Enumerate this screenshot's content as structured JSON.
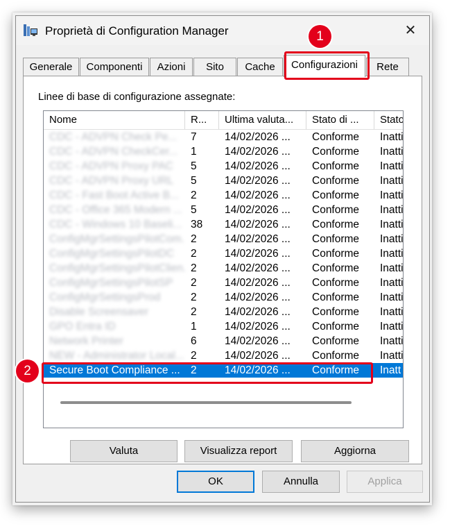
{
  "window": {
    "title": "Proprietà di Configuration Manager",
    "close_glyph": "✕",
    "icon": "configmgr-app-icon"
  },
  "tabs": [
    {
      "label": "Generale"
    },
    {
      "label": "Componenti"
    },
    {
      "label": "Azioni"
    },
    {
      "label": "Sito"
    },
    {
      "label": "Cache"
    },
    {
      "label": "Configurazioni",
      "active": true
    },
    {
      "label": "Rete"
    }
  ],
  "panel": {
    "assigned_label": "Linee di base di configurazione assegnate:"
  },
  "list": {
    "columns": [
      "Nome",
      "R...",
      "Ultima valuta...",
      "Stato di ...",
      "Stato"
    ],
    "rows": [
      {
        "name": "CDC - ADVPN Check Pe...",
        "rev": "7",
        "last_eval": "14/02/2026 ...",
        "compliance": "Conforme",
        "state": "Inattivo",
        "obscured": true
      },
      {
        "name": "CDC - ADVPN CheckCer...",
        "rev": "1",
        "last_eval": "14/02/2026 ...",
        "compliance": "Conforme",
        "state": "Inattivo",
        "obscured": true
      },
      {
        "name": "CDC - ADVPN Proxy PAC",
        "rev": "5",
        "last_eval": "14/02/2026 ...",
        "compliance": "Conforme",
        "state": "Inattivo",
        "obscured": true
      },
      {
        "name": "CDC - ADVPN Proxy URL",
        "rev": "5",
        "last_eval": "14/02/2026 ...",
        "compliance": "Conforme",
        "state": "Inattivo",
        "obscured": true
      },
      {
        "name": "CDC - Fast Boot Active B...",
        "rev": "2",
        "last_eval": "14/02/2026 ...",
        "compliance": "Conforme",
        "state": "Inattivo",
        "obscured": true
      },
      {
        "name": "CDC - Office 365 Modern ...",
        "rev": "5",
        "last_eval": "14/02/2026 ...",
        "compliance": "Conforme",
        "state": "Inattivo",
        "obscured": true
      },
      {
        "name": "CDC - Windows 10 Baseli...",
        "rev": "38",
        "last_eval": "14/02/2026 ...",
        "compliance": "Conforme",
        "state": "Inattivo",
        "obscured": true
      },
      {
        "name": "ConfigMgrSettingsPilotCom...",
        "rev": "2",
        "last_eval": "14/02/2026 ...",
        "compliance": "Conforme",
        "state": "Inattivo",
        "obscured": true
      },
      {
        "name": "ConfigMgrSettingsPilotDC",
        "rev": "2",
        "last_eval": "14/02/2026 ...",
        "compliance": "Conforme",
        "state": "Inattivo",
        "obscured": true
      },
      {
        "name": "ConfigMgrSettingsPilotClien...",
        "rev": "2",
        "last_eval": "14/02/2026 ...",
        "compliance": "Conforme",
        "state": "Inattivo",
        "obscured": true
      },
      {
        "name": "ConfigMgrSettingsPilotSP",
        "rev": "2",
        "last_eval": "14/02/2026 ...",
        "compliance": "Conforme",
        "state": "Inattivo",
        "obscured": true
      },
      {
        "name": "ConfigMgrSettingsProd",
        "rev": "2",
        "last_eval": "14/02/2026 ...",
        "compliance": "Conforme",
        "state": "Inattivo",
        "obscured": true
      },
      {
        "name": "Disable Screensaver",
        "rev": "2",
        "last_eval": "14/02/2026 ...",
        "compliance": "Conforme",
        "state": "Inattivo",
        "obscured": true
      },
      {
        "name": "GPO Entra ID",
        "rev": "1",
        "last_eval": "14/02/2026 ...",
        "compliance": "Conforme",
        "state": "Inattivo",
        "obscured": true
      },
      {
        "name": "Network Printer",
        "rev": "6",
        "last_eval": "14/02/2026 ...",
        "compliance": "Conforme",
        "state": "Inattivo",
        "obscured": true
      },
      {
        "name": "NEW - Administrator Local...",
        "rev": "2",
        "last_eval": "14/02/2026 ...",
        "compliance": "Conforme",
        "state": "Inattivo",
        "obscured": true
      },
      {
        "name": "Secure Boot Compliance ...",
        "rev": "2",
        "last_eval": "14/02/2026 ...",
        "compliance": "Conforme",
        "state": "Inatt",
        "selected": true
      }
    ]
  },
  "buttons": {
    "valuta": "Valuta",
    "visualizza_report": "Visualizza report",
    "aggiorna": "Aggiorna",
    "ok": "OK",
    "annulla": "Annulla",
    "applica": "Applica"
  },
  "annotations": {
    "callout_1": "1",
    "callout_2": "2",
    "color": "#e3001b"
  },
  "colors": {
    "selection": "#0078d7",
    "window_bg": "#f0f0f0"
  }
}
